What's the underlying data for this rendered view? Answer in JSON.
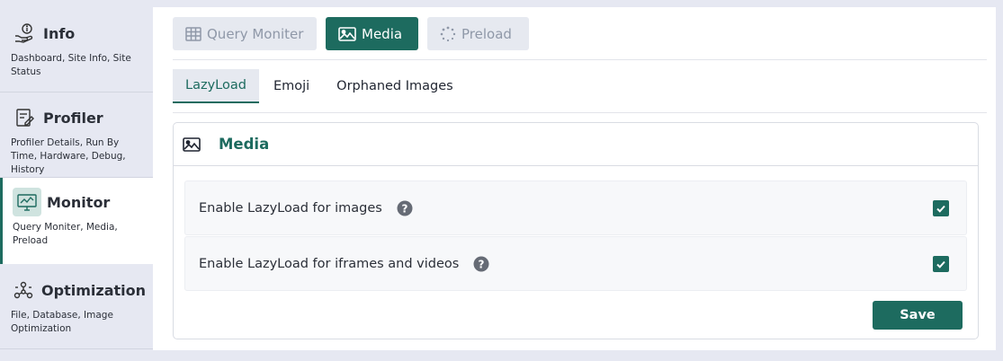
{
  "sidebar": {
    "items": [
      {
        "icon": "info-icon",
        "title": "Info",
        "sub": "Dashboard, Site Info, Site Status"
      },
      {
        "icon": "profiler-icon",
        "title": "Profiler",
        "sub": "Profiler Details, Run By Time, Hardware, Debug, History"
      },
      {
        "icon": "monitor-icon",
        "title": "Monitor",
        "sub": "Query Moniter, Media, Preload"
      },
      {
        "icon": "optimization-icon",
        "title": "Optimization",
        "sub": "File, Database, Image Optimization"
      }
    ],
    "active_index": 2
  },
  "top_tabs": [
    {
      "icon": "table-icon",
      "label": "Query Moniter"
    },
    {
      "icon": "image-icon",
      "label": "Media"
    },
    {
      "icon": "spinner-icon",
      "label": "Preload"
    }
  ],
  "top_tab_active": "Media",
  "sub_tabs": [
    "LazyLoad",
    "Emoji",
    "Orphaned Images"
  ],
  "sub_tab_active": "LazyLoad",
  "card": {
    "icon": "image-icon",
    "title": "Media",
    "options": [
      {
        "label": "Enable LazyLoad for images",
        "checked": true
      },
      {
        "label": "Enable LazyLoad for iframes and videos",
        "checked": true
      }
    ],
    "save_label": "Save"
  },
  "colors": {
    "accent": "#1d6b5f",
    "sidebar_bg": "#e6e8f2",
    "tab_inactive_bg": "#e6e9f0",
    "tab_inactive_text": "#8f98a8"
  }
}
